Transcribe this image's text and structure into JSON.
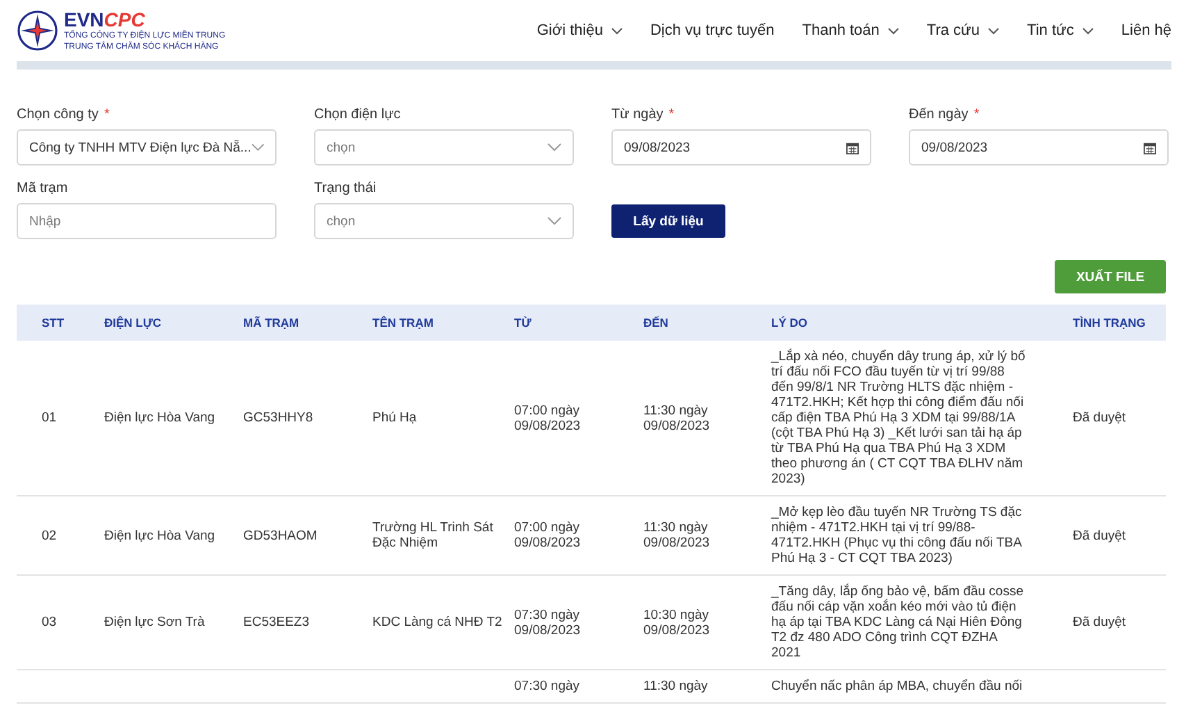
{
  "header": {
    "logo": {
      "brand_main": "EVN",
      "brand_accent": "CPC",
      "line_1": "TỔNG CÔNG TY ĐIỆN LỰC MIỀN TRUNG",
      "line_2": "TRUNG TÂM CHĂM SÓC KHÁCH HÀNG"
    },
    "nav": [
      {
        "label": "Giới thiệu",
        "has_menu": true
      },
      {
        "label": "Dịch vụ trực tuyến",
        "has_menu": false
      },
      {
        "label": "Thanh toán",
        "has_menu": true
      },
      {
        "label": "Tra cứu",
        "has_menu": true
      },
      {
        "label": "Tin tức",
        "has_menu": true
      },
      {
        "label": "Liên hệ",
        "has_menu": false
      }
    ]
  },
  "filters": [
    {
      "kind": "select",
      "label": "Chọn công ty",
      "required_mark": "*",
      "value": "Công ty TNHH MTV Điện lực Đà Nẵ..."
    },
    {
      "kind": "select",
      "label": "Chọn điện lực",
      "placeholder": "chọn"
    },
    {
      "kind": "date",
      "label": "Từ ngày",
      "required_mark": "*",
      "value": "09/08/2023"
    },
    {
      "kind": "date",
      "label": "Đến ngày",
      "required_mark": "*",
      "value": "09/08/2023"
    },
    {
      "kind": "text",
      "label": "Mã trạm",
      "placeholder": "Nhập"
    },
    {
      "kind": "select",
      "label": "Trạng thái",
      "placeholder": "chọn"
    },
    {
      "kind": "button",
      "label": "Lấy dữ liệu"
    }
  ],
  "export_button": "XUẤT FILE",
  "table": {
    "columns": [
      "STT",
      "ĐIỆN LỰC",
      "MÃ TRẠM",
      "TÊN TRẠM",
      "TỪ",
      "ĐẾN",
      "LÝ DO",
      "TÌNH TRẠNG"
    ],
    "rows": [
      [
        "01",
        "Điện lực Hòa Vang",
        "GC53HHY8",
        "Phú Hạ",
        "07:00 ngày 09/08/2023",
        "11:30 ngày 09/08/2023",
        "_Lắp xà néo, chuyển dây trung áp, xử lý bố trí đấu nối FCO đầu tuyến từ vị trí 99/88 đến 99/8/1 NR Trường HLTS đặc nhiệm - 471T2.HKH; Kết hợp thi công điểm đấu nối cấp điện TBA Phú Hạ 3 XDM tại 99/88/1A (cột TBA Phú Hạ 3) _Kết lưới san tải hạ áp từ TBA Phú Hạ qua TBA Phú Hạ 3 XDM theo phương án ( CT CQT TBA ĐLHV năm 2023)",
        "Đã duyệt"
      ],
      [
        "02",
        "Điện lực Hòa Vang",
        "GD53HAOM",
        "Trường HL Trinh Sát Đặc Nhiệm",
        "07:00 ngày 09/08/2023",
        "11:30 ngày 09/08/2023",
        "_Mở kẹp lèo đầu tuyến NR Trường TS đặc nhiệm - 471T2.HKH tại vị trí 99/88-471T2.HKH (Phục vụ thi công đấu nối TBA Phú Hạ 3 - CT CQT TBA 2023)",
        "Đã duyệt"
      ],
      [
        "03",
        "Điện lực Sơn Trà",
        "EC53EEZ3",
        "KDC Làng cá NHĐ T2",
        "07:30 ngày 09/08/2023",
        "10:30 ngày 09/08/2023",
        "_Tăng dây, lắp ống bảo vệ, bấm đầu cosse đấu nối cáp vặn xoắn kéo mới vào tủ điện hạ áp tại TBA KDC Làng cá Nại Hiên Đông T2 đz 480 ADO Công trình CQT ĐZHA 2021",
        "Đã duyệt"
      ],
      [
        "",
        "",
        "",
        "",
        "07:30 ngày",
        "11:30 ngày",
        "Chuyển nấc phân áp MBA, chuyển đầu nối",
        ""
      ]
    ]
  }
}
